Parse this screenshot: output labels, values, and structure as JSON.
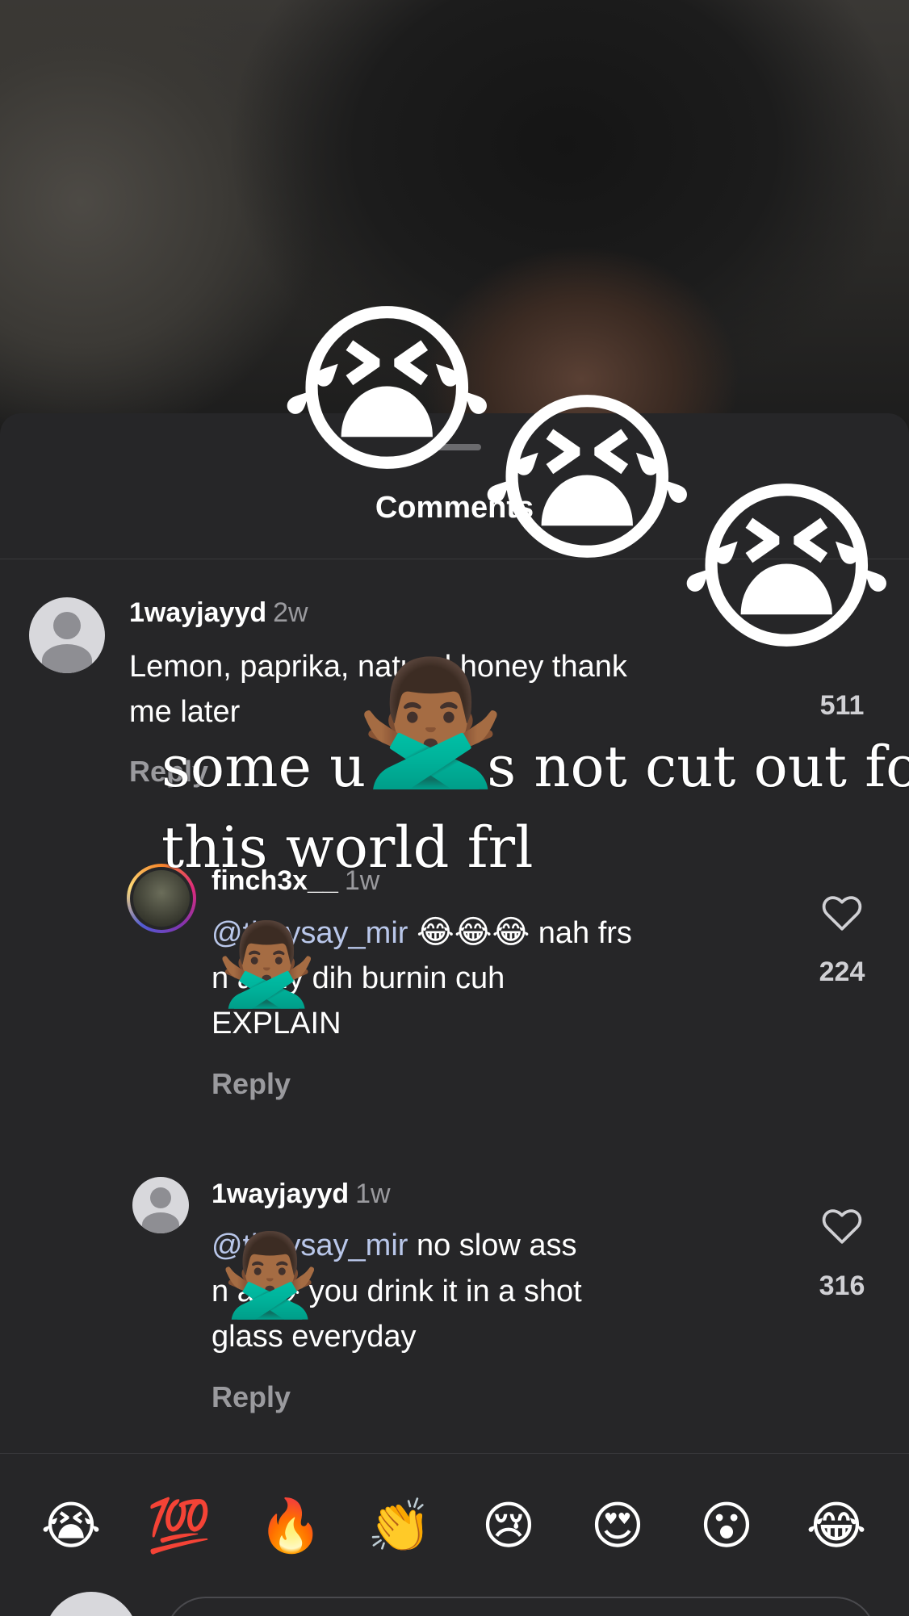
{
  "sheet": {
    "title": "Comments"
  },
  "comments": [
    {
      "user": "1wayjayyd",
      "time": "2w",
      "text_line1": "Lemon, paprika, natural honey thank",
      "text_line2": "me later",
      "likes": "511",
      "reply": "Reply"
    },
    {
      "user": "finch3x__",
      "time": "1w",
      "mention": "@theysay_mir",
      "text_tail": " nah frs",
      "text_line2": "n   a my dih burnin cuh",
      "text_line3": "EXPLAIN",
      "likes": "224",
      "reply": "Reply"
    },
    {
      "user": "1wayjayyd",
      "time": "1w",
      "mention": "@theysay_mir",
      "text_tail": " no slow ass",
      "text_line2a": "n   a ",
      "text_line2b": " you drink it in a shot",
      "text_line3": "glass everyday",
      "likes": "316",
      "reply": "Reply"
    }
  ],
  "overlay": {
    "caption_line1a": "some u",
    "caption_line1b": "s not cut out for",
    "caption_line2": "this world frl"
  },
  "quick_emojis": [
    "😭",
    "💯",
    "🔥",
    "👏",
    "😢",
    "😍",
    "😮",
    "😂"
  ],
  "colors": {
    "sheet_bg": "#262628",
    "muted": "#9a9a9e",
    "mention": "#b9c7ea"
  }
}
